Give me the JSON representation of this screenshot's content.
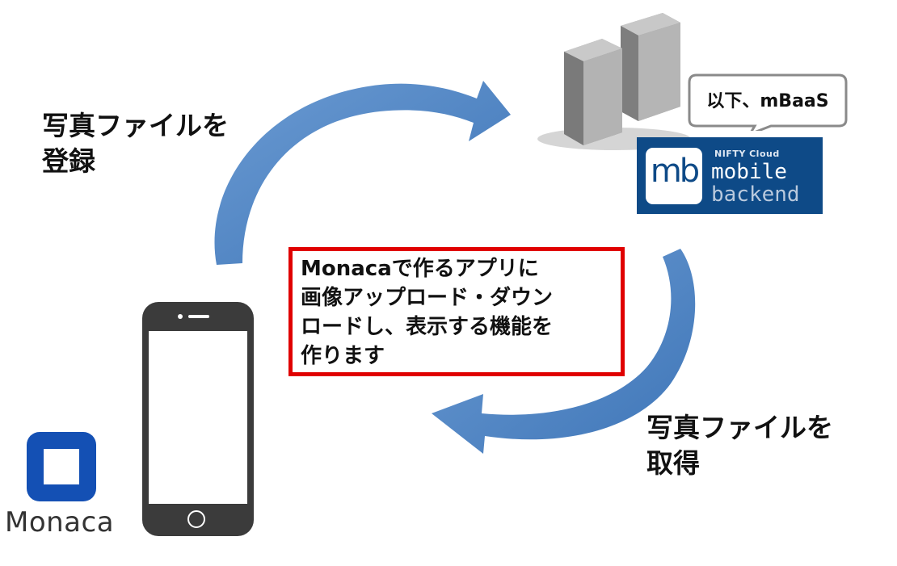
{
  "labels": {
    "upload": "写真ファイルを\n登録",
    "download": "写真ファイルを\n取得"
  },
  "main_box": {
    "line1": "Monacaで作るアプリに",
    "line2": "画像アップロード・ダウン",
    "line3": "ロードし、表示する機能を",
    "line4": "作ります"
  },
  "callout": {
    "text": "以下、mBaaS"
  },
  "mb_logo": {
    "mark": "mb",
    "vendor": "NIFTY Cloud",
    "word1": "mobile",
    "word2": "backend"
  },
  "monaca": {
    "name": "Monaca"
  },
  "colors": {
    "arrow": "#4f86c6",
    "box_border": "#e00000",
    "mb_bg": "#0e4a87",
    "monaca_blue": "#1450b4"
  },
  "icons": {
    "servers": "server-icon",
    "phone": "smartphone-icon"
  }
}
